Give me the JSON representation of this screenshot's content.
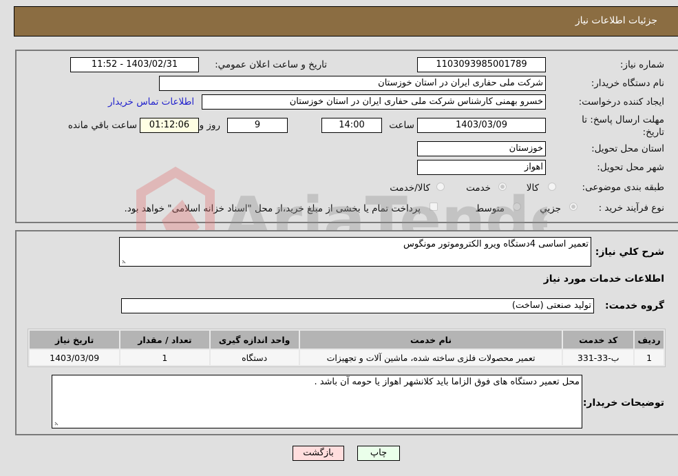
{
  "header": {
    "title": "جزئیات اطلاعات نیاز"
  },
  "form": {
    "need_number_label": "شماره نیاز:",
    "need_number": "1103093985001789",
    "announce_label": "تاریخ و ساعت اعلان عمومي:",
    "announce_value": "1403/02/31 - 11:52",
    "buyer_org_label": "نام دستگاه خریدار:",
    "buyer_org": "شرکت ملی حفاری ایران در استان خوزستان",
    "creator_label": "ایجاد کننده درخواست:",
    "creator": "خسرو بهمنی کارشناس  شرکت ملی حفاری ایران در استان خوزستان",
    "contact_link": "اطلاعات تماس خریدار",
    "deadline_label": "مهلت ارسال پاسخ: تا تاریخ:",
    "deadline_date": "1403/03/09",
    "time_label": "ساعت",
    "deadline_time": "14:00",
    "days_value": "9",
    "days_label": "روز و",
    "remaining_time": "01:12:06",
    "remaining_label": "ساعت باقي مانده",
    "province_label": "استان محل تحویل:",
    "province": "خوزستان",
    "city_label": "شهر محل تحویل:",
    "city": "اهواز",
    "category_label": "طبقه بندی موضوعی:",
    "category_options": [
      "کالا",
      "خدمت",
      "کالا/خدمت"
    ],
    "category_selected": "خدمت",
    "process_label": "نوع فرآیند خرید :",
    "process_options": [
      "جزیي",
      "متوسط"
    ],
    "process_selected": "جزیي",
    "payment_note": "پرداخت تمام یا بخشی از مبلغ خرید،از محل \"اسناد خزانه اسلامی\" خواهد بود."
  },
  "details": {
    "description_label": "شرح كلي نياز:",
    "description": "تعمیر اساسی 4دستگاه ویرو الکتروموتور مونگوس",
    "services_title": "اطلاعات خدمات مورد نیاز",
    "service_group_label": "گروه خدمت:",
    "service_group": "تولید صنعتی (ساخت)",
    "table": {
      "headers": [
        "ردیف",
        "کد خدمت",
        "نام خدمت",
        "واحد اندازه گیری",
        "تعداد / مقدار",
        "تاریخ نیاز"
      ],
      "rows": [
        [
          "1",
          "ب-33-331",
          "تعمیر محصولات فلزی ساخته شده، ماشین آلات و تجهیزات",
          "دستگاه",
          "1",
          "1403/03/09"
        ]
      ]
    },
    "buyer_notes_label": "توضیحات خریدار:",
    "buyer_notes": "محل تعمیر دستگاه های فوق الزاما باید کلانشهر اهواز یا حومه آن باشد ."
  },
  "buttons": {
    "print": "چاپ",
    "back": "بازگشت"
  },
  "colors": {
    "header_bg": "#8b6d42",
    "print_bg": "#eaffea",
    "back_bg": "#ffdddd",
    "link": "#2222cc"
  }
}
